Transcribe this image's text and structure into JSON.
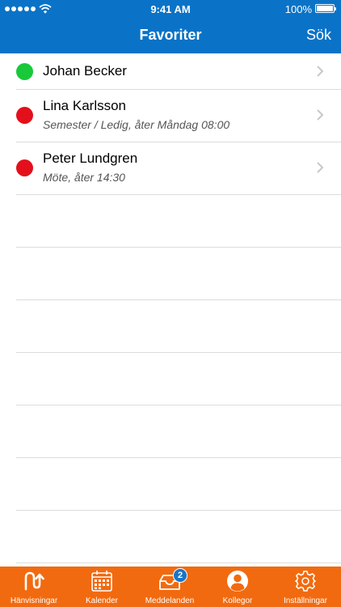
{
  "status_bar": {
    "time": "9:41 AM",
    "battery": "100%"
  },
  "header": {
    "title": "Favoriter",
    "search_label": "Sök"
  },
  "contacts": [
    {
      "name": "Johan Becker",
      "status": "",
      "presence_color": "#19c93a"
    },
    {
      "name": "Lina Karlsson",
      "status": "Semester / Ledig, åter Måndag 08:00",
      "presence_color": "#e3101c"
    },
    {
      "name": "Peter Lundgren",
      "status": "Möte, åter 14:30",
      "presence_color": "#e3101c"
    }
  ],
  "tabs": [
    {
      "label": "Hänvisningar",
      "icon": "referral-icon"
    },
    {
      "label": "Kalender",
      "icon": "calendar-icon"
    },
    {
      "label": "Meddelanden",
      "icon": "inbox-icon",
      "badge": "2"
    },
    {
      "label": "Kollegor",
      "icon": "colleague-icon",
      "selected": true
    },
    {
      "label": "Inställningar",
      "icon": "gear-icon"
    }
  ],
  "colors": {
    "header": "#0a73c7",
    "tabbar": "#f26a0f",
    "badge": "#1a74c6"
  }
}
